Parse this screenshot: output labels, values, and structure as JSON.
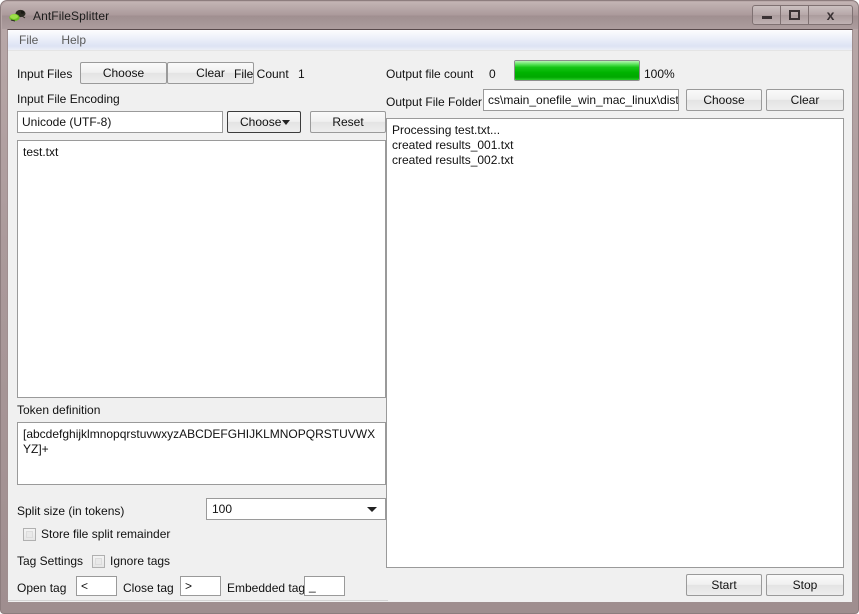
{
  "window": {
    "title": "AntFileSplitter",
    "icon": "ant-icon",
    "controls": {
      "minimize": "minimize-icon",
      "maximize": "maximize-icon",
      "close": "close-icon"
    }
  },
  "menubar": {
    "items": [
      {
        "label": "File"
      },
      {
        "label": "Help"
      }
    ]
  },
  "left": {
    "input_files_label": "Input Files",
    "choose_files_button": "Choose",
    "clear_files_button": "Clear",
    "file_count_label": "File Count",
    "file_count_value": "1",
    "encoding_label": "Input File Encoding",
    "encoding_value": "Unicode (UTF-8)",
    "encoding_choose_button": "Choose",
    "encoding_reset_button": "Reset",
    "file_list": "test.txt",
    "token_definition_label": "Token definition",
    "token_definition_value": "[abcdefghijklmnopqrstuvwxyzABCDEFGHIJKLMNOPQRSTUVWXYZ]+",
    "split_size_label": "Split size (in tokens)",
    "split_size_value": "100",
    "store_remainder_label": "Store file split remainder",
    "store_remainder_checked": "false",
    "tag_settings_label": "Tag Settings",
    "ignore_tags_label": "Ignore tags",
    "ignore_tags_checked": "false",
    "open_tag_label": "Open tag",
    "open_tag_value": "<",
    "close_tag_label": "Close tag",
    "close_tag_value": ">",
    "embedded_tag_label": "Embedded tag",
    "embedded_tag_value": "_"
  },
  "right": {
    "output_count_label": "Output file count",
    "output_count_value": "0",
    "progress_percent_label": "100%",
    "progress_percent_value": 100,
    "output_folder_label": "Output File Folder",
    "output_folder_value": "cs\\main_onefile_win_mac_linux\\dist",
    "output_choose_button": "Choose",
    "output_clear_button": "Clear",
    "log_text": "Processing test.txt...\ncreated results_001.txt\ncreated results_002.txt",
    "start_button": "Start",
    "stop_button": "Stop"
  },
  "colors": {
    "frame": "#a9989a",
    "client": "#f0f0f0",
    "progress_green": "#00b300",
    "field_border": "#9a9a9a"
  }
}
